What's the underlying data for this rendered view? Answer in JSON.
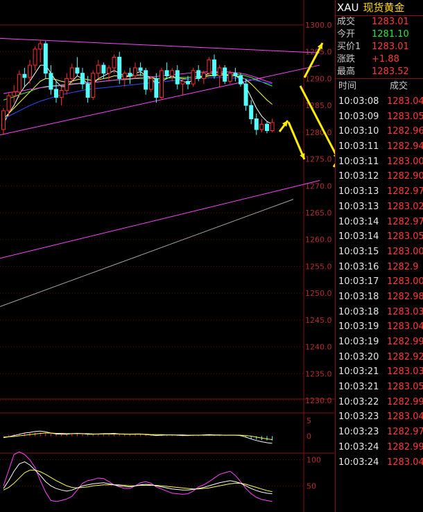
{
  "header": {
    "symbol": "XAU",
    "name": "现货黄金"
  },
  "quote": [
    {
      "label": "成交",
      "value": "1283.01",
      "color": "#ff3a3a"
    },
    {
      "label": "今开",
      "value": "1281.10",
      "color": "#2ee62e"
    },
    {
      "label": "买价1",
      "value": "1283.01",
      "color": "#ff3a3a"
    },
    {
      "label": "涨跌",
      "value": "+1.88",
      "color": "#ff3a3a"
    },
    {
      "label": "最高",
      "value": "1283.52",
      "color": "#ff3a3a"
    }
  ],
  "ticks_header": {
    "time": "时间",
    "price": "成交"
  },
  "ticks": [
    {
      "time": "10:03:08",
      "price": "1283.04"
    },
    {
      "time": "10:03:09",
      "price": "1283.05"
    },
    {
      "time": "10:03:10",
      "price": "1282.96"
    },
    {
      "time": "10:03:11",
      "price": "1282.94"
    },
    {
      "time": "10:03:11",
      "price": "1283.00"
    },
    {
      "time": "10:03:12",
      "price": "1282.90"
    },
    {
      "time": "10:03:13",
      "price": "1282.97"
    },
    {
      "time": "10:03:13",
      "price": "1283.02"
    },
    {
      "time": "10:03:14",
      "price": "1282.97"
    },
    {
      "time": "10:03:14",
      "price": "1283.05"
    },
    {
      "time": "10:03:15",
      "price": "1283.00"
    },
    {
      "time": "10:03:16",
      "price": "1282.9"
    },
    {
      "time": "10:03:17",
      "price": "1283.00"
    },
    {
      "time": "10:03:18",
      "price": "1282.98"
    },
    {
      "time": "10:03:18",
      "price": "1283.03"
    },
    {
      "time": "10:03:19",
      "price": "1283.04"
    },
    {
      "time": "10:03:19",
      "price": "1282.99"
    },
    {
      "time": "10:03:20",
      "price": "1282.92"
    },
    {
      "time": "10:03:21",
      "price": "1283.03"
    },
    {
      "time": "10:03:21",
      "price": "1283.05"
    },
    {
      "time": "10:03:22",
      "price": "1282.99"
    },
    {
      "time": "10:03:23",
      "price": "1283.04"
    },
    {
      "time": "10:03:23",
      "price": "1282.97"
    },
    {
      "time": "10:03:24",
      "price": "1282.99"
    },
    {
      "time": "10:03:24",
      "price": "1283.04"
    }
  ],
  "chart_data": {
    "type": "candlestick",
    "main": {
      "price_axis": [
        "1300.0",
        "1295.0",
        "1290.0",
        "1285.0",
        "1280.0",
        "1275.0",
        "1270.0",
        "1265.0",
        "1260.0",
        "1255.0",
        "1250.0",
        "1245.0",
        "1240.0",
        "1235.0",
        "1230.0"
      ],
      "ylim": [
        1230,
        1300
      ],
      "up_color": "#ff3030",
      "down_color": "#54ffff",
      "candles": [
        [
          1280.5,
          1284.5,
          1279.5,
          1284.0
        ],
        [
          1284.0,
          1287.5,
          1283.0,
          1286.8
        ],
        [
          1286.8,
          1288.8,
          1285.5,
          1287.5
        ],
        [
          1287.5,
          1291.5,
          1286.5,
          1290.8
        ],
        [
          1290.8,
          1292.0,
          1288.5,
          1290.2
        ],
        [
          1290.2,
          1293.5,
          1289.0,
          1292.5
        ],
        [
          1292.5,
          1296.0,
          1291.5,
          1295.5
        ],
        [
          1295.5,
          1297.2,
          1293.0,
          1296.5
        ],
        [
          1296.5,
          1297.0,
          1290.0,
          1291.0
        ],
        [
          1291.0,
          1292.5,
          1287.0,
          1288.0
        ],
        [
          1288.0,
          1289.5,
          1285.5,
          1286.5
        ],
        [
          1286.5,
          1288.5,
          1285.0,
          1287.8
        ],
        [
          1287.8,
          1291.0,
          1287.0,
          1290.0
        ],
        [
          1290.0,
          1292.8,
          1289.0,
          1292.0
        ],
        [
          1292.0,
          1294.0,
          1290.5,
          1291.0
        ],
        [
          1291.0,
          1292.0,
          1288.0,
          1289.0
        ],
        [
          1289.0,
          1290.5,
          1285.5,
          1286.5
        ],
        [
          1286.5,
          1291.5,
          1286.0,
          1291.0
        ],
        [
          1291.0,
          1293.5,
          1290.0,
          1292.5
        ],
        [
          1292.5,
          1293.0,
          1290.0,
          1291.0
        ],
        [
          1291.0,
          1292.5,
          1289.5,
          1292.0
        ],
        [
          1292.0,
          1294.5,
          1291.0,
          1294.0
        ],
        [
          1294.0,
          1295.0,
          1289.0,
          1290.0
        ],
        [
          1290.0,
          1291.5,
          1288.5,
          1291.0
        ],
        [
          1291.0,
          1292.0,
          1289.0,
          1290.5
        ],
        [
          1290.5,
          1293.0,
          1290.0,
          1292.0
        ],
        [
          1292.0,
          1293.0,
          1290.5,
          1291.5
        ],
        [
          1291.5,
          1292.0,
          1287.0,
          1288.0
        ],
        [
          1288.0,
          1290.5,
          1287.5,
          1290.0
        ],
        [
          1290.0,
          1291.0,
          1285.5,
          1286.5
        ],
        [
          1286.5,
          1292.0,
          1286.0,
          1291.5
        ],
        [
          1291.5,
          1293.0,
          1290.0,
          1290.5
        ],
        [
          1290.5,
          1292.0,
          1289.5,
          1291.5
        ],
        [
          1291.5,
          1292.5,
          1288.0,
          1289.0
        ],
        [
          1289.0,
          1290.0,
          1287.0,
          1289.5
        ],
        [
          1289.5,
          1290.5,
          1288.0,
          1289.0
        ],
        [
          1289.0,
          1292.0,
          1288.5,
          1291.5
        ],
        [
          1291.5,
          1292.5,
          1289.5,
          1290.0
        ],
        [
          1290.0,
          1291.5,
          1289.0,
          1291.0
        ],
        [
          1291.0,
          1294.0,
          1290.5,
          1293.5
        ],
        [
          1293.5,
          1294.5,
          1290.0,
          1290.5
        ],
        [
          1290.5,
          1292.5,
          1288.5,
          1292.0
        ],
        [
          1292.0,
          1292.5,
          1289.0,
          1289.5
        ],
        [
          1289.5,
          1291.5,
          1289.0,
          1291.0
        ],
        [
          1291.0,
          1292.0,
          1289.5,
          1290.5
        ],
        [
          1290.5,
          1291.0,
          1288.5,
          1289.0
        ],
        [
          1289.0,
          1290.0,
          1284.0,
          1285.0
        ],
        [
          1285.0,
          1286.0,
          1281.5,
          1282.5
        ],
        [
          1282.5,
          1283.5,
          1279.5,
          1280.5
        ],
        [
          1280.5,
          1282.5,
          1280.0,
          1281.5
        ],
        [
          1281.5,
          1282.0,
          1279.8,
          1280.3
        ],
        [
          1280.3,
          1282.5,
          1280.0,
          1281.8
        ]
      ],
      "ma_lines": [
        {
          "color": "#ffffff",
          "values": [
            1281.5,
            1283.5,
            1285.0,
            1287.0,
            1288.5,
            1289.5,
            1291.0,
            1292.5,
            1292.5,
            1291.0,
            1289.5,
            1288.5,
            1288.5,
            1289.5,
            1290.5,
            1290.0,
            1289.0,
            1289.0,
            1290.0,
            1290.5,
            1291.0,
            1291.5,
            1291.0,
            1290.5,
            1290.5,
            1291.0,
            1291.3,
            1290.5,
            1290.0,
            1289.0,
            1289.5,
            1290.0,
            1290.5,
            1290.0,
            1289.5,
            1289.2,
            1289.8,
            1290.2,
            1290.5,
            1291.0,
            1291.0,
            1291.2,
            1290.8,
            1290.5,
            1290.5,
            1290.0,
            1288.5,
            1286.5,
            1284.5,
            1283.0,
            1282.0,
            1281.5
          ]
        },
        {
          "color": "#ffff44",
          "values": [
            1282.5,
            1283.5,
            1284.5,
            1285.5,
            1286.5,
            1287.5,
            1288.5,
            1289.5,
            1290.0,
            1290.0,
            1289.8,
            1289.5,
            1289.3,
            1289.5,
            1289.8,
            1290.0,
            1289.8,
            1289.6,
            1289.8,
            1290.0,
            1290.2,
            1290.5,
            1290.5,
            1290.4,
            1290.4,
            1290.6,
            1290.7,
            1290.5,
            1290.3,
            1290.0,
            1290.0,
            1290.1,
            1290.2,
            1290.1,
            1290.0,
            1289.9,
            1290.0,
            1290.2,
            1290.3,
            1290.5,
            1290.6,
            1290.7,
            1290.6,
            1290.5,
            1290.5,
            1290.3,
            1289.8,
            1289.0,
            1288.0,
            1287.0,
            1286.0,
            1285.2
          ]
        },
        {
          "color": "#44ff44",
          "values": [
            1286.0,
            1286.3,
            1286.6,
            1287.0,
            1287.3,
            1287.6,
            1288.0,
            1288.3,
            1288.5,
            1288.6,
            1288.7,
            1288.8,
            1288.9,
            1289.0,
            1289.1,
            1289.2,
            1289.2,
            1289.3,
            1289.4,
            1289.5,
            1289.6,
            1289.7,
            1289.8,
            1289.8,
            1289.9,
            1290.0,
            1290.0,
            1290.0,
            1290.0,
            1290.0,
            1290.0,
            1290.1,
            1290.2,
            1290.2,
            1290.2,
            1290.2,
            1290.3,
            1290.4,
            1290.5,
            1290.6,
            1290.7,
            1290.8,
            1290.8,
            1290.8,
            1290.8,
            1290.7,
            1290.5,
            1290.2,
            1289.8,
            1289.4,
            1289.0,
            1288.6
          ]
        },
        {
          "color": "#ff44ff",
          "values": [
            1287.2,
            1287.4,
            1287.5,
            1287.7,
            1287.8,
            1288.0,
            1288.1,
            1288.3,
            1288.4,
            1288.5,
            1288.6,
            1288.7,
            1288.8,
            1288.9,
            1289.0,
            1289.1,
            1289.2,
            1289.3,
            1289.4,
            1289.5,
            1289.6,
            1289.7,
            1289.8,
            1289.9,
            1290.0,
            1290.1,
            1290.2,
            1290.3,
            1290.3,
            1290.4,
            1290.5,
            1290.6,
            1290.7,
            1290.8,
            1290.9,
            1291.0,
            1291.1,
            1291.2,
            1291.2,
            1291.3,
            1291.3,
            1291.3,
            1291.3,
            1291.2,
            1291.1,
            1291.0,
            1290.8,
            1290.5,
            1290.2,
            1289.8,
            1289.5,
            1289.2
          ]
        },
        {
          "color": "#3050ff",
          "values": [
            1282.5,
            1283.0,
            1283.5,
            1284.0,
            1284.5,
            1285.0,
            1285.4,
            1285.8,
            1286.1,
            1286.4,
            1286.7,
            1287.0,
            1287.2,
            1287.4,
            1287.6,
            1287.8,
            1288.0,
            1288.1,
            1288.2,
            1288.3,
            1288.4,
            1288.5,
            1288.6,
            1288.7,
            1288.8,
            1288.9,
            1289.0,
            1289.1,
            1289.2,
            1289.3,
            1289.4,
            1289.5,
            1289.6,
            1289.7,
            1289.8,
            1289.9,
            1290.0,
            1290.1,
            1290.1,
            1290.2,
            1290.2,
            1290.2,
            1290.2,
            1290.2,
            1290.1,
            1290.0,
            1289.9,
            1289.8,
            1289.6,
            1289.4,
            1289.2,
            1289.0
          ]
        }
      ],
      "trendlines": [
        {
          "color": "#ff44ff",
          "points": [
            [
              0,
              1297.5
            ],
            [
              60,
              1294.8
            ]
          ]
        },
        {
          "color": "#ff44ff",
          "points": [
            [
              0,
              1279.5
            ],
            [
              60,
              1292.5
            ]
          ]
        },
        {
          "color": "#ff44ff",
          "points": [
            [
              0,
              1256.5
            ],
            [
              60,
              1271.0
            ]
          ]
        },
        {
          "color": "#aaaaaa",
          "points": [
            [
              0,
              1247.5
            ],
            [
              55,
              1267.5
            ]
          ]
        }
      ],
      "annotation_color": "#ffee00"
    },
    "macd": {
      "axis": [
        "5",
        "0"
      ],
      "ylim": [
        -5,
        7
      ],
      "bars": [
        0.2,
        0.4,
        0.6,
        0.8,
        1.0,
        1.1,
        1.2,
        1.2,
        1.1,
        0.9,
        0.8,
        0.7,
        0.7,
        0.8,
        0.9,
        0.9,
        0.8,
        0.7,
        0.7,
        0.8,
        0.8,
        0.9,
        0.8,
        0.7,
        0.6,
        0.6,
        0.6,
        0.5,
        0.4,
        0.3,
        0.3,
        0.3,
        0.3,
        0.2,
        0.1,
        0.1,
        0.2,
        0.2,
        0.3,
        0.3,
        0.3,
        0.2,
        0.1,
        0.0,
        0.0,
        -0.1,
        -0.4,
        -0.8,
        -1.1,
        -1.3,
        -1.4,
        -1.4
      ],
      "dif": [
        -0.5,
        -0.2,
        0.2,
        0.6,
        1.0,
        1.2,
        1.5,
        1.6,
        1.4,
        1.0,
        0.7,
        0.6,
        0.6,
        0.8,
        0.9,
        0.8,
        0.6,
        0.6,
        0.7,
        0.8,
        0.8,
        0.9,
        0.7,
        0.6,
        0.6,
        0.7,
        0.7,
        0.5,
        0.4,
        0.2,
        0.3,
        0.4,
        0.4,
        0.3,
        0.2,
        0.2,
        0.3,
        0.3,
        0.4,
        0.5,
        0.4,
        0.4,
        0.3,
        0.3,
        0.3,
        0.2,
        -0.3,
        -0.9,
        -1.4,
        -1.8,
        -2.1,
        -2.3
      ],
      "dea": [
        -0.3,
        -0.2,
        -0.1,
        0.1,
        0.3,
        0.5,
        0.7,
        0.9,
        1.0,
        1.0,
        0.9,
        0.9,
        0.8,
        0.8,
        0.8,
        0.8,
        0.8,
        0.7,
        0.7,
        0.7,
        0.7,
        0.7,
        0.7,
        0.7,
        0.6,
        0.6,
        0.6,
        0.6,
        0.5,
        0.5,
        0.5,
        0.4,
        0.4,
        0.4,
        0.4,
        0.3,
        0.3,
        0.3,
        0.3,
        0.3,
        0.3,
        0.3,
        0.3,
        0.3,
        0.3,
        0.3,
        0.2,
        0.0,
        -0.3,
        -0.6,
        -0.9,
        -1.1
      ]
    },
    "kdj": {
      "axis": [
        "100",
        "50"
      ],
      "ylim": [
        0,
        110
      ],
      "k": [
        45,
        60,
        78,
        92,
        96,
        90,
        80,
        70,
        58,
        50,
        45,
        42,
        40,
        42,
        46,
        50,
        52,
        54,
        55,
        56,
        54,
        52,
        50,
        49,
        48,
        50,
        52,
        53,
        52,
        50,
        48,
        46,
        44,
        43,
        42,
        42,
        43,
        45,
        47,
        50,
        53,
        56,
        58,
        60,
        58,
        55,
        50,
        45,
        41,
        38,
        36,
        35
      ],
      "d": [
        42,
        47,
        55,
        65,
        75,
        80,
        80,
        77,
        72,
        66,
        60,
        55,
        50,
        47,
        46,
        47,
        48,
        50,
        51,
        52,
        52,
        52,
        52,
        51,
        50,
        50,
        51,
        51,
        51,
        51,
        50,
        49,
        48,
        47,
        46,
        45,
        44,
        44,
        45,
        46,
        48,
        50,
        52,
        54,
        55,
        55,
        53,
        50,
        47,
        44,
        41,
        39
      ],
      "j": [
        50,
        80,
        110,
        115,
        110,
        100,
        85,
        60,
        38,
        22,
        20,
        22,
        25,
        30,
        42,
        55,
        60,
        62,
        65,
        64,
        58,
        52,
        48,
        45,
        45,
        50,
        56,
        58,
        55,
        48,
        44,
        40,
        36,
        35,
        34,
        35,
        40,
        48,
        52,
        58,
        65,
        72,
        75,
        78,
        70,
        58,
        45,
        35,
        28,
        24,
        22,
        20
      ]
    }
  }
}
